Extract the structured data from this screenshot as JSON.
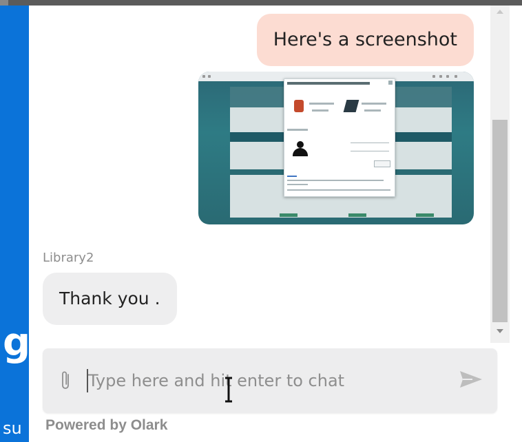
{
  "background_page": {
    "letter": "g",
    "text": "su"
  },
  "messages": [
    {
      "from": "visitor",
      "text": "Here's a screenshot"
    },
    {
      "from": "visitor",
      "type": "image",
      "image_name": "screenshot-thumbnail"
    },
    {
      "from": "operator",
      "sender": "Library2",
      "text": "Thank you ."
    }
  ],
  "compose": {
    "placeholder": "Type here and hit enter to chat",
    "value": ""
  },
  "footer": {
    "powered_by": "Powered by Olark"
  },
  "icons": {
    "attach": "paperclip-icon",
    "send": "send-icon"
  },
  "colors": {
    "visitor_bubble": "#fcdcd2",
    "operator_bubble": "#eeeeef",
    "side_blue": "#0b73d9"
  }
}
